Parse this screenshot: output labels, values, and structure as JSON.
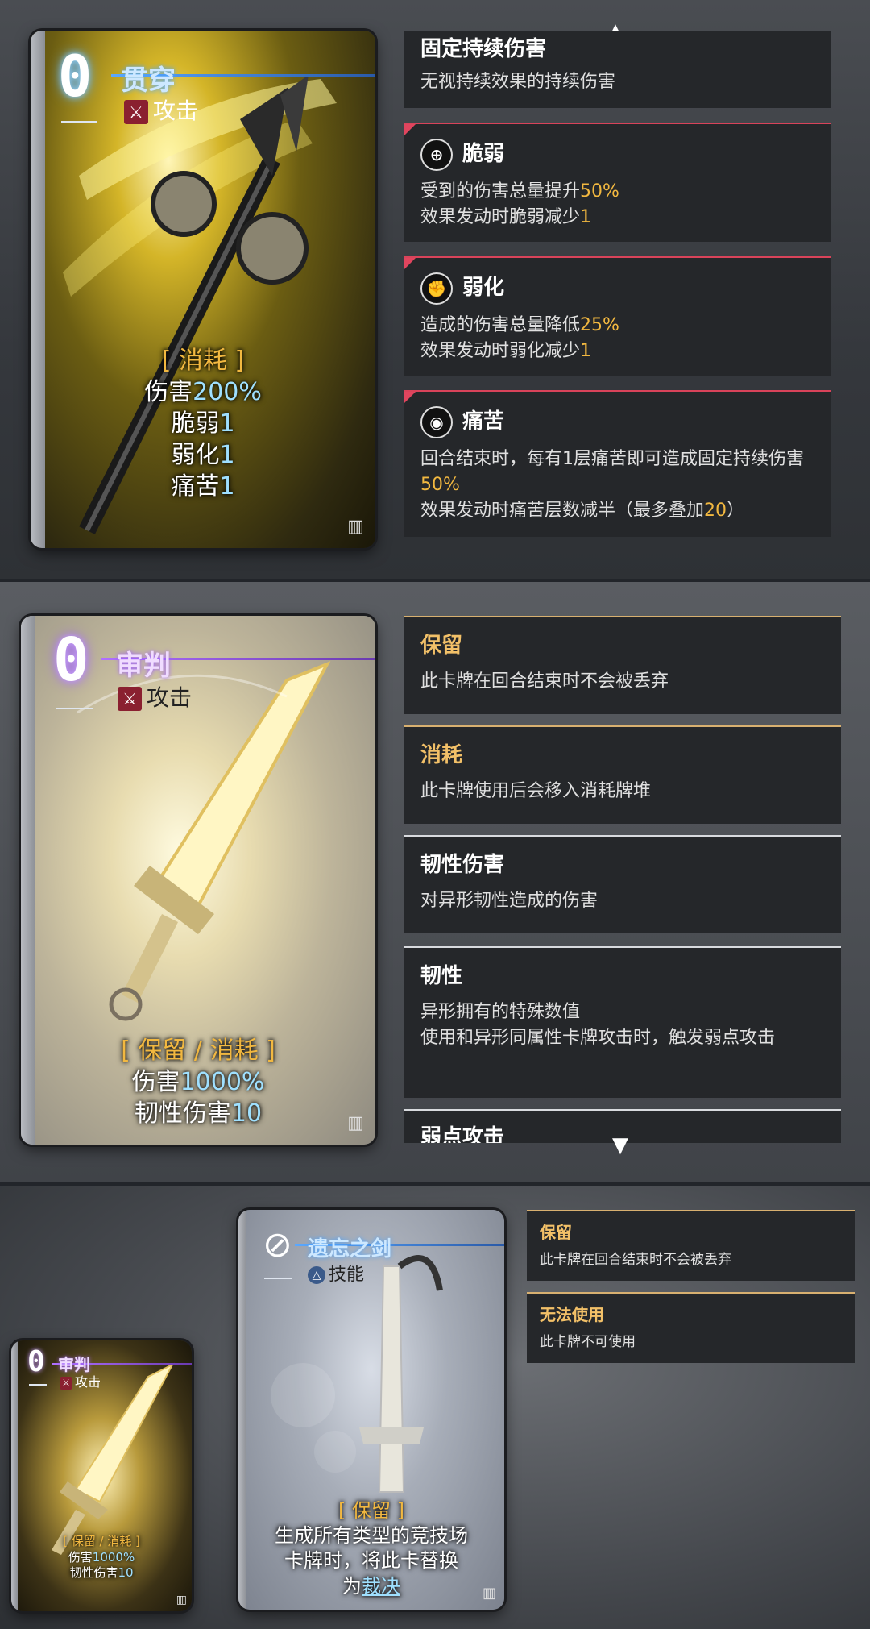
{
  "sec1": {
    "card": {
      "cost": "0",
      "name": "贯穿",
      "type": "攻击",
      "tag": "[ 消耗 ]",
      "lines": [
        {
          "label": "伤害",
          "value": "200%"
        },
        {
          "label": "脆弱",
          "value": "1"
        },
        {
          "label": "弱化",
          "value": "1"
        },
        {
          "label": "痛苦",
          "value": "1"
        }
      ]
    },
    "panels": [
      {
        "title": "固定持续伤害",
        "desc": "无视持续效果的持续伤害"
      },
      {
        "title": "脆弱",
        "icon": "⊕",
        "desc1a": "受到的伤害总量提升",
        "desc1b": "50%",
        "desc2a": "效果发动时脆弱减少",
        "desc2b": "1"
      },
      {
        "title": "弱化",
        "icon": "✊",
        "desc1a": "造成的伤害总量降低",
        "desc1b": "25%",
        "desc2a": "效果发动时弱化减少",
        "desc2b": "1"
      },
      {
        "title": "痛苦",
        "icon": "◉",
        "desc1a": "回合结束时，每有1层痛苦即可造成固定持续伤害",
        "desc1b": "50%",
        "desc2a": "效果发动时痛苦层数减半（最多叠加",
        "desc2b": "20",
        "desc2c": "）"
      }
    ]
  },
  "sec2": {
    "card": {
      "cost": "0",
      "name": "审判",
      "type": "攻击",
      "tag": "[ 保留 / 消耗 ]",
      "lines": [
        {
          "label": "伤害",
          "value": "1000%"
        },
        {
          "label": "韧性伤害",
          "value": "10"
        }
      ]
    },
    "panels": [
      {
        "title": "保留",
        "desc": "此卡牌在回合结束时不会被丢弃"
      },
      {
        "title": "消耗",
        "desc": "此卡牌使用后会移入消耗牌堆"
      },
      {
        "title": "韧性伤害",
        "desc": "对异形韧性造成的伤害"
      },
      {
        "title": "韧性",
        "desc": "异形拥有的特殊数值\n使用和异形同属性卡牌攻击时，触发弱点攻击"
      },
      {
        "title": "弱点攻击"
      }
    ]
  },
  "sec3": {
    "small_card": {
      "cost": "0",
      "name": "审判",
      "type": "攻击",
      "tag": "[ 保留 / 消耗 ]",
      "line1a": "伤害",
      "line1b": "1000%",
      "line2a": "韧性伤害",
      "line2b": "10"
    },
    "card": {
      "cost": "⊘",
      "name": "遗忘之剑",
      "type": "技能",
      "tag": "[ 保留 ]",
      "text1": "生成所有类型的竞技场",
      "text2": "卡牌时，将此卡替换",
      "text3a": "为",
      "text3b": "裁决"
    },
    "panels": [
      {
        "title": "保留",
        "desc": "此卡牌在回合结束时不会被丢弃"
      },
      {
        "title": "无法使用",
        "desc": "此卡牌不可使用"
      }
    ]
  },
  "icons": {
    "up": "triangle-up",
    "down": "triangle-down",
    "grate": "colosseum"
  },
  "colors": {
    "accent_gold": "#f2b840",
    "panel_bg": "#25272a",
    "red_border": "#d9435a"
  }
}
